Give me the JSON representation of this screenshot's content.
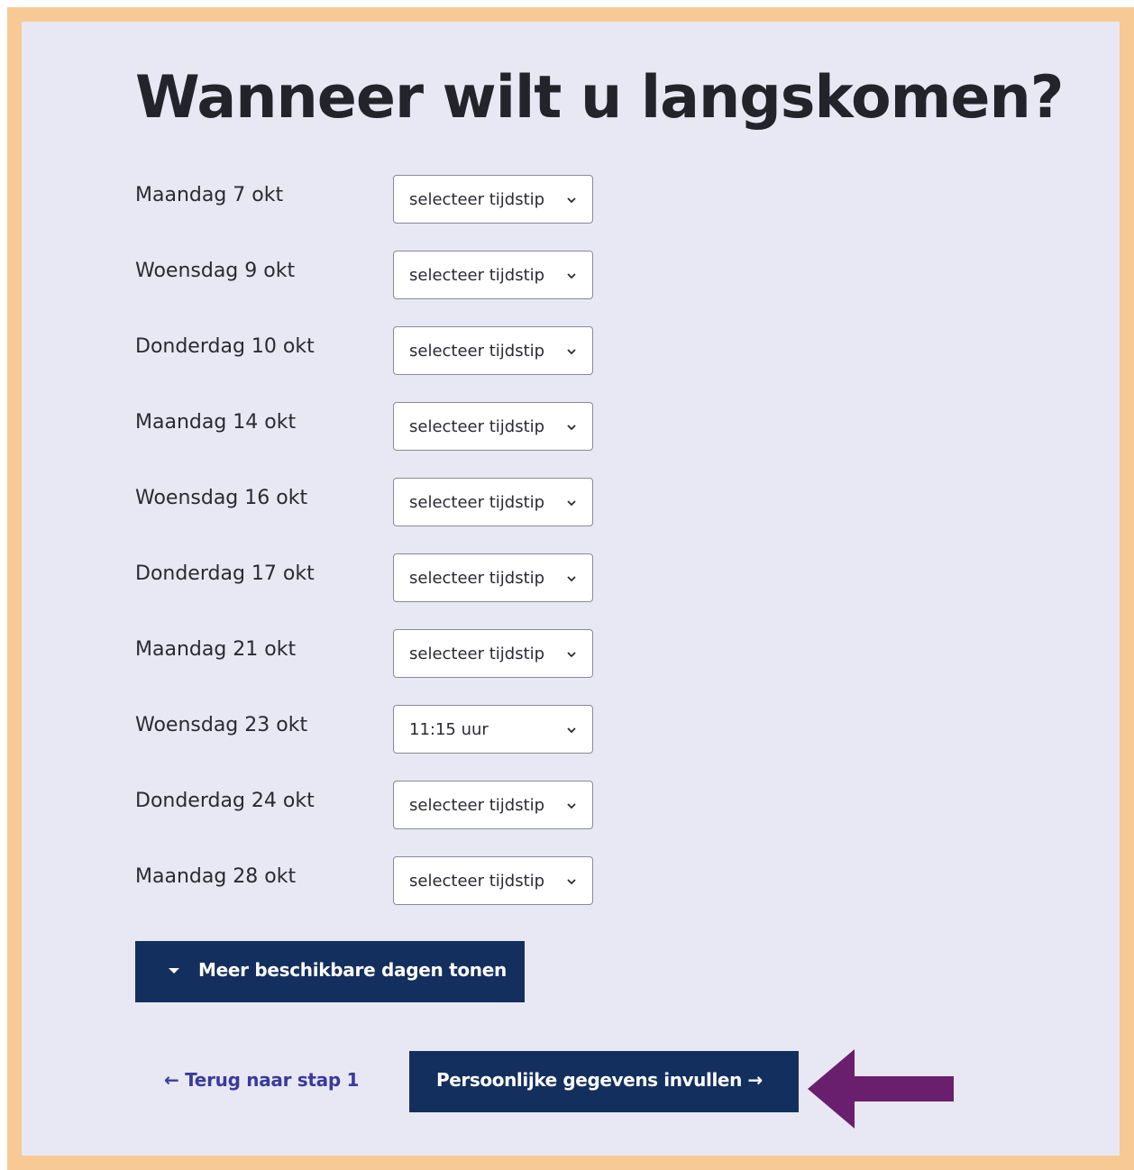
{
  "page": {
    "title": "Wanneer wilt u langskomen?"
  },
  "days": [
    {
      "label": "Maandag 7 okt",
      "value": "selecteer tijdstip"
    },
    {
      "label": "Woensdag 9 okt",
      "value": "selecteer tijdstip"
    },
    {
      "label": "Donderdag 10 okt",
      "value": "selecteer tijdstip"
    },
    {
      "label": "Maandag 14 okt",
      "value": "selecteer tijdstip"
    },
    {
      "label": "Woensdag 16 okt",
      "value": "selecteer tijdstip"
    },
    {
      "label": "Donderdag 17 okt",
      "value": "selecteer tijdstip"
    },
    {
      "label": "Maandag 21 okt",
      "value": "selecteer tijdstip"
    },
    {
      "label": "Woensdag 23 okt",
      "value": "11:15 uur"
    },
    {
      "label": "Donderdag 24 okt",
      "value": "selecteer tijdstip"
    },
    {
      "label": "Maandag 28 okt",
      "value": "selecteer tijdstip"
    }
  ],
  "actions": {
    "more_days_label": "Meer beschikbare dagen tonen",
    "back_label": "← Terug naar stap 1",
    "next_label": "Persoonlijke gegevens invullen →"
  },
  "colors": {
    "frame": "#f7c994",
    "background": "#e8e8f4",
    "button": "#132f5e",
    "link": "#3a3a9c",
    "annotation_arrow": "#6a1f6e"
  }
}
